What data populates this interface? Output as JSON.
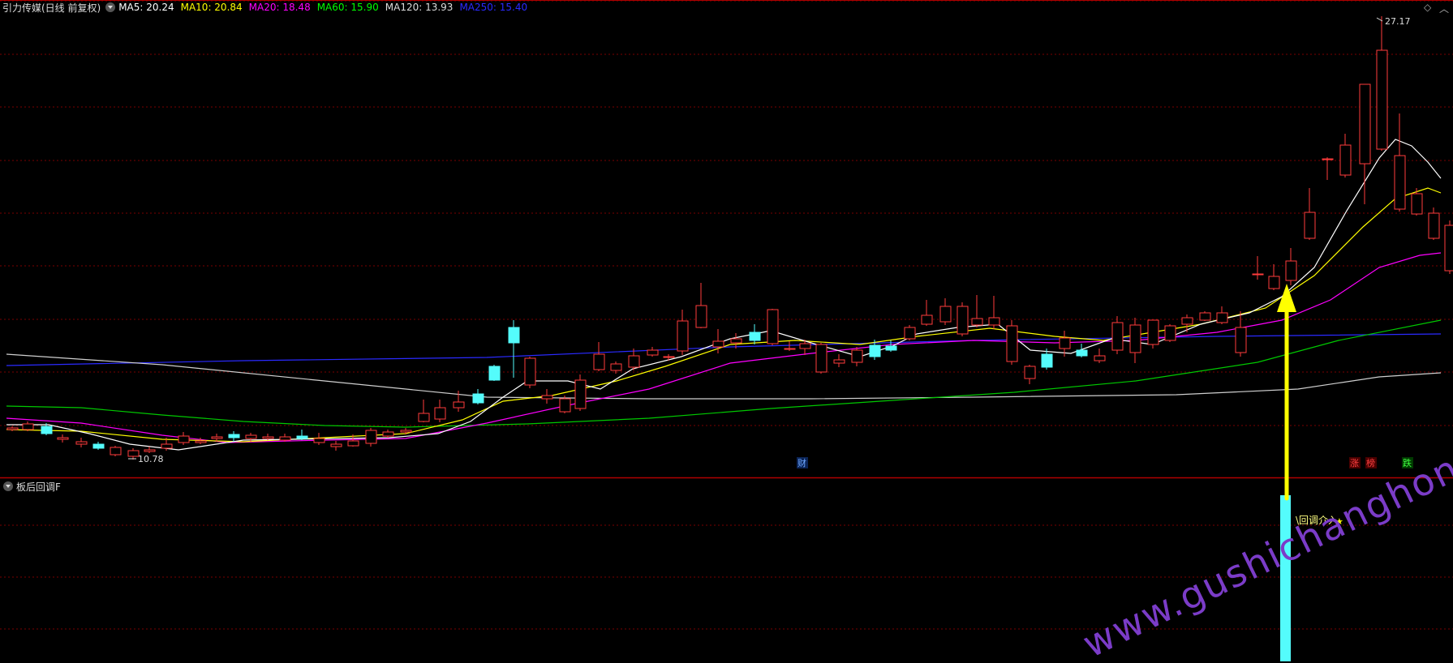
{
  "header": {
    "title": "引力传媒(日线 前复权)",
    "ma": [
      {
        "label": "MA5: 20.24",
        "color": "#ffffff"
      },
      {
        "label": "MA10: 20.84",
        "color": "#ffff00"
      },
      {
        "label": "MA20: 18.48",
        "color": "#ff00ff"
      },
      {
        "label": "MA60: 15.90",
        "color": "#00ff00"
      },
      {
        "label": "MA120: 13.93",
        "color": "#dddddd"
      },
      {
        "label": "MA250: 15.40",
        "color": "#0000ff"
      }
    ],
    "corner_icons": [
      "diamond-icon",
      "chevron-up-icon"
    ]
  },
  "main_chart": {
    "high_label": "27.17",
    "low_label": "10.78",
    "markers": [
      {
        "text": "财",
        "color": "#6ea8ff",
        "bg": "#0b2457"
      },
      {
        "text": "涨",
        "color": "#ff4040",
        "bg": "#4a0000"
      },
      {
        "text": "榜",
        "color": "#ff4040",
        "bg": "#4a0000"
      },
      {
        "text": "跌",
        "color": "#40ff40",
        "bg": "#003a00"
      }
    ],
    "colors": {
      "up": "#ff3c3c",
      "down": "#54fcfc",
      "grid": "#7a0000",
      "divider": "#b00000",
      "arrow": "#ffff00"
    }
  },
  "indicator": {
    "name": "板后回调F",
    "signal_label": "回调介入",
    "signal_star": "★"
  },
  "watermark": "www.gushichanghong.com"
}
